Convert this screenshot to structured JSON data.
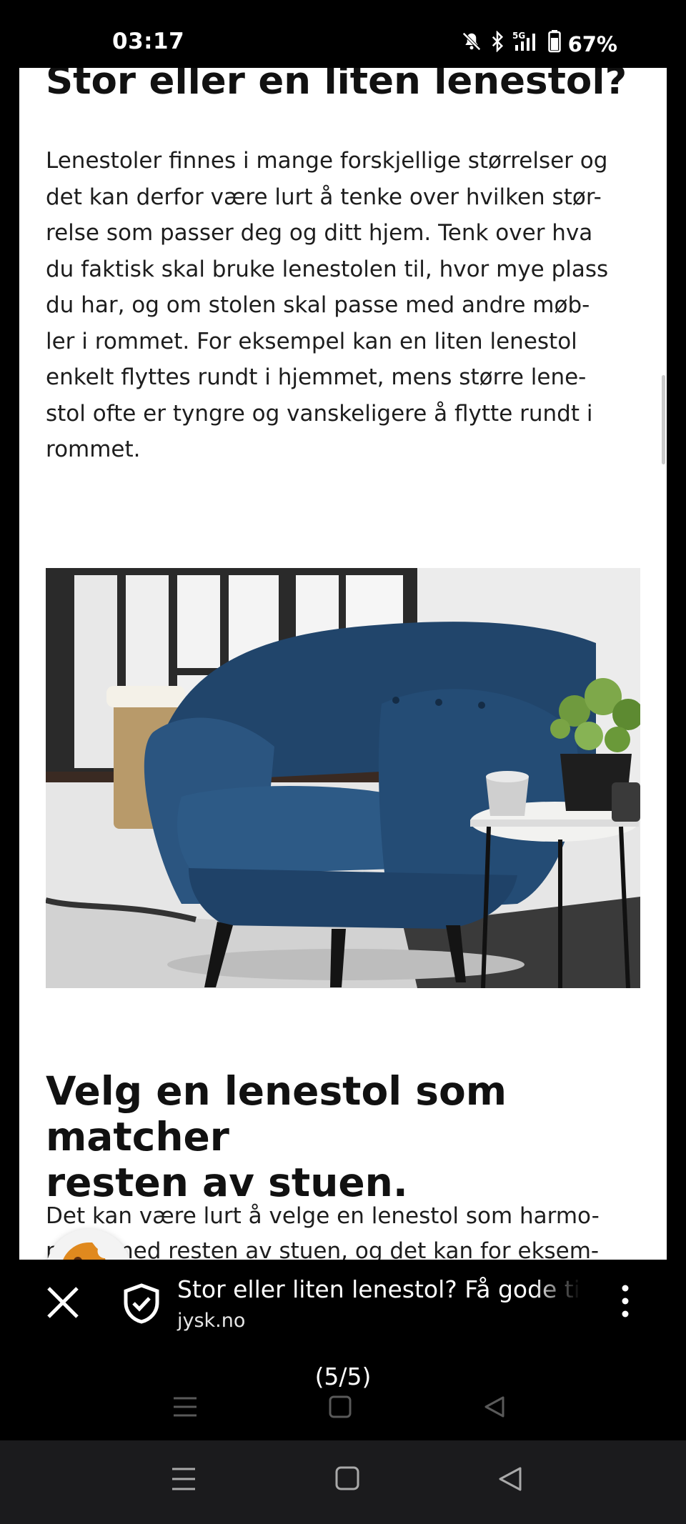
{
  "status_bar": {
    "time": "03:17",
    "network": "5G",
    "battery": "67%",
    "icons": [
      "bell-muted-icon",
      "bluetooth-icon",
      "signal-icon",
      "battery-icon"
    ]
  },
  "article": {
    "heading1": "Stor eller en liten lenestol?",
    "paragraph1": "Lenestoler finnes i mange forskjellige størrelser og\ndet kan derfor være lurt å tenke over hvilken stør-\nrelse som passer deg og ditt hjem. Tenk over hva\ndu faktisk skal bruke lenestolen til, hvor mye plass\ndu har, og om stolen skal passe med andre møb-\nler i rommet. For eksempel kan en liten lenestol\nenkelt flyttes rundt i hjemmet, mens større lene-\nstol ofte er tyngre og vanskeligere å flytte rundt i\nrommet.",
    "heading2": "Velg en lenestol som matcher\nresten av stuen.",
    "paragraph2": "Det kan være lurt å velge en lenestol som harmo-\nnerer med resten av stuen, og det kan for eksem-"
  },
  "custom_tab": {
    "title": "Stor eller liten lenestol? Få gode tips",
    "domain": "jysk.no"
  },
  "preview": {
    "counter": "(5/5)"
  },
  "colors": {
    "chair_blue": "#2b4f74",
    "background": "#000000",
    "page": "#ffffff",
    "navbar": "#1b1b1d"
  }
}
